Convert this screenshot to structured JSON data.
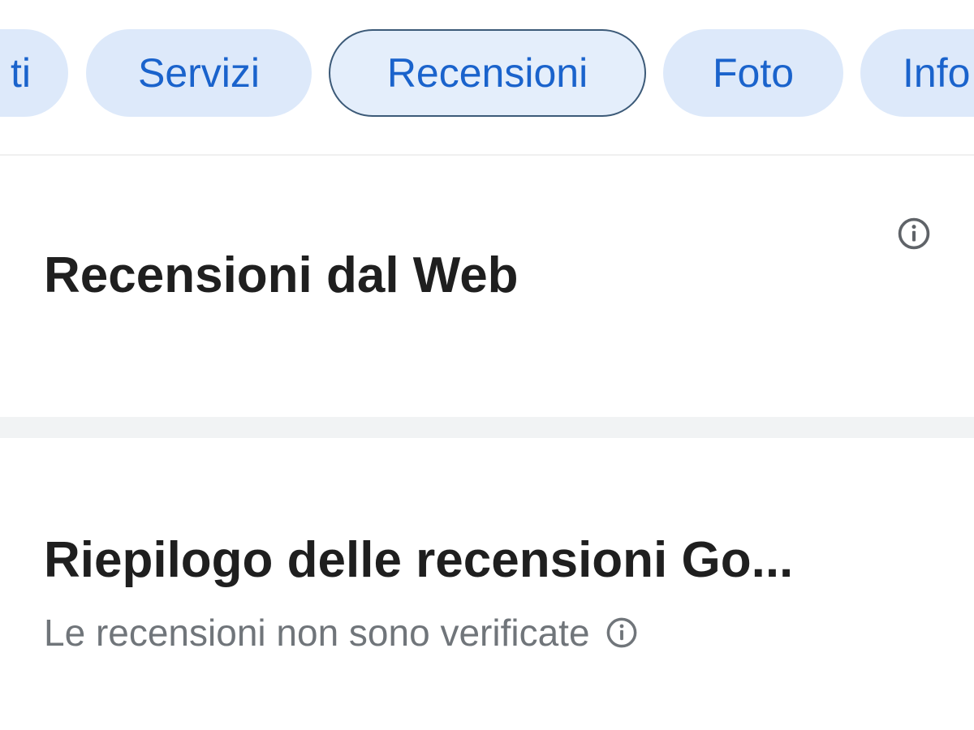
{
  "tabs": [
    {
      "label": "ti"
    },
    {
      "label": "Servizi"
    },
    {
      "label": "Recensioni",
      "selected": true
    },
    {
      "label": "Foto"
    },
    {
      "label": "Info"
    }
  ],
  "web_reviews": {
    "title": "Recensioni dal Web",
    "info_icon": "info-icon"
  },
  "summary": {
    "title": "Riepilogo delle recensioni Go...",
    "note": "Le recensioni non sono verificate",
    "info_icon": "info-icon"
  },
  "colors": {
    "tab_background": "#dde9fa",
    "tab_text": "#1a63cc",
    "selected_tab_border": "#3c5a78",
    "title_text": "#1f1f1f",
    "secondary_text": "#70757a",
    "divider": "#f1f3f4"
  }
}
